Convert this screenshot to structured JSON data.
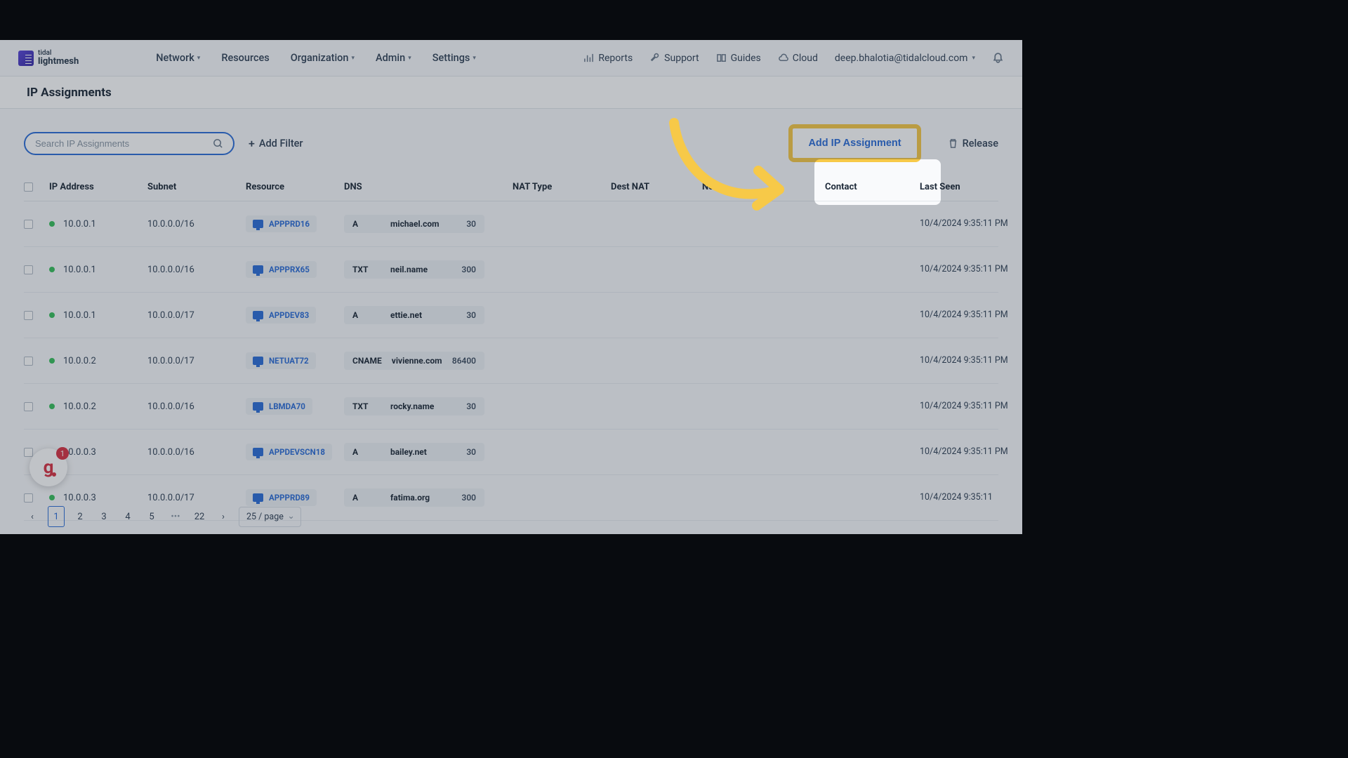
{
  "brand": {
    "top": "tidal",
    "bottom": "lightmesh"
  },
  "nav": {
    "network": "Network",
    "resources": "Resources",
    "organization": "Organization",
    "admin": "Admin",
    "settings": "Settings"
  },
  "top_links": {
    "reports": "Reports",
    "support": "Support",
    "guides": "Guides",
    "cloud": "Cloud",
    "user": "deep.bhalotia@tidalcloud.com"
  },
  "page_title": "IP Assignments",
  "search": {
    "placeholder": "Search IP Assignments"
  },
  "buttons": {
    "add_filter": "Add Filter",
    "add_assignment": "Add IP Assignment",
    "release": "Release",
    "help_badge": "1"
  },
  "columns": {
    "ip": "IP Address",
    "subnet": "Subnet",
    "resource": "Resource",
    "dns": "DNS",
    "nat_type": "NAT Type",
    "dest_nat": "Dest NAT",
    "notes": "Notes",
    "contact": "Contact",
    "last_seen": "Last Seen"
  },
  "rows": [
    {
      "ip": "10.0.0.1",
      "subnet": "10.0.0.0/16",
      "resource": "APPPRD16",
      "dns_type": "A",
      "dns_host": "michael.com",
      "dns_ttl": "30",
      "last_seen": "10/4/2024 9:35:11 PM"
    },
    {
      "ip": "10.0.0.1",
      "subnet": "10.0.0.0/16",
      "resource": "APPPRX65",
      "dns_type": "TXT",
      "dns_host": "neil.name",
      "dns_ttl": "300",
      "last_seen": "10/4/2024 9:35:11 PM"
    },
    {
      "ip": "10.0.0.1",
      "subnet": "10.0.0.0/17",
      "resource": "APPDEV83",
      "dns_type": "A",
      "dns_host": "ettie.net",
      "dns_ttl": "30",
      "last_seen": "10/4/2024 9:35:11 PM"
    },
    {
      "ip": "10.0.0.2",
      "subnet": "10.0.0.0/17",
      "resource": "NETUAT72",
      "dns_type": "CNAME",
      "dns_host": "vivienne.com",
      "dns_ttl": "86400",
      "last_seen": "10/4/2024 9:35:11 PM"
    },
    {
      "ip": "10.0.0.2",
      "subnet": "10.0.0.0/16",
      "resource": "LBMDA70",
      "dns_type": "TXT",
      "dns_host": "rocky.name",
      "dns_ttl": "30",
      "last_seen": "10/4/2024 9:35:11 PM"
    },
    {
      "ip": "10.0.0.3",
      "subnet": "10.0.0.0/16",
      "resource": "APPDEVSCN18",
      "dns_type": "A",
      "dns_host": "bailey.net",
      "dns_ttl": "30",
      "last_seen": "10/4/2024 9:35:11 PM"
    },
    {
      "ip": "10.0.0.3",
      "subnet": "10.0.0.0/17",
      "resource": "APPPRD89",
      "dns_type": "A",
      "dns_host": "fatima.org",
      "dns_ttl": "300",
      "last_seen": "10/4/2024 9:35:11"
    }
  ],
  "pagination": {
    "pages": [
      "1",
      "2",
      "3",
      "4",
      "5"
    ],
    "ellipsis": "•••",
    "last": "22",
    "size_label": "25 / page"
  }
}
